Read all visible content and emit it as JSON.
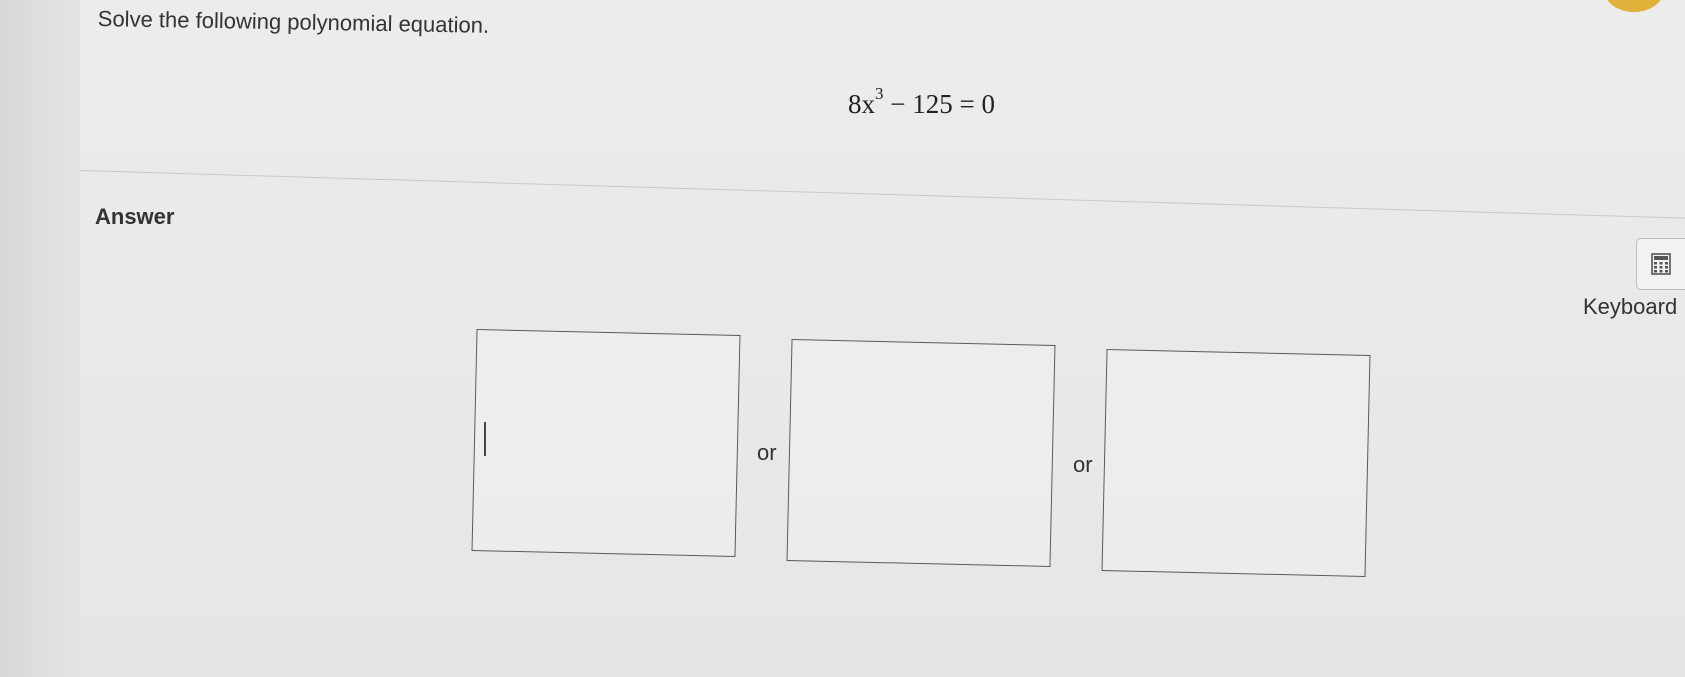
{
  "question": {
    "prompt": "Solve the following polynomial equation.",
    "equation": {
      "coefficient": "8x",
      "exponent": "3",
      "rest": " − 125 = 0"
    }
  },
  "answer": {
    "label": "Answer",
    "separator": "or",
    "inputs": [
      {
        "value": ""
      },
      {
        "value": ""
      },
      {
        "value": ""
      }
    ]
  },
  "tools": {
    "calculator_icon": "calculator-icon",
    "keyboard_label": "Keyboard"
  },
  "colors": {
    "accent_badge": "#e2b13a"
  }
}
